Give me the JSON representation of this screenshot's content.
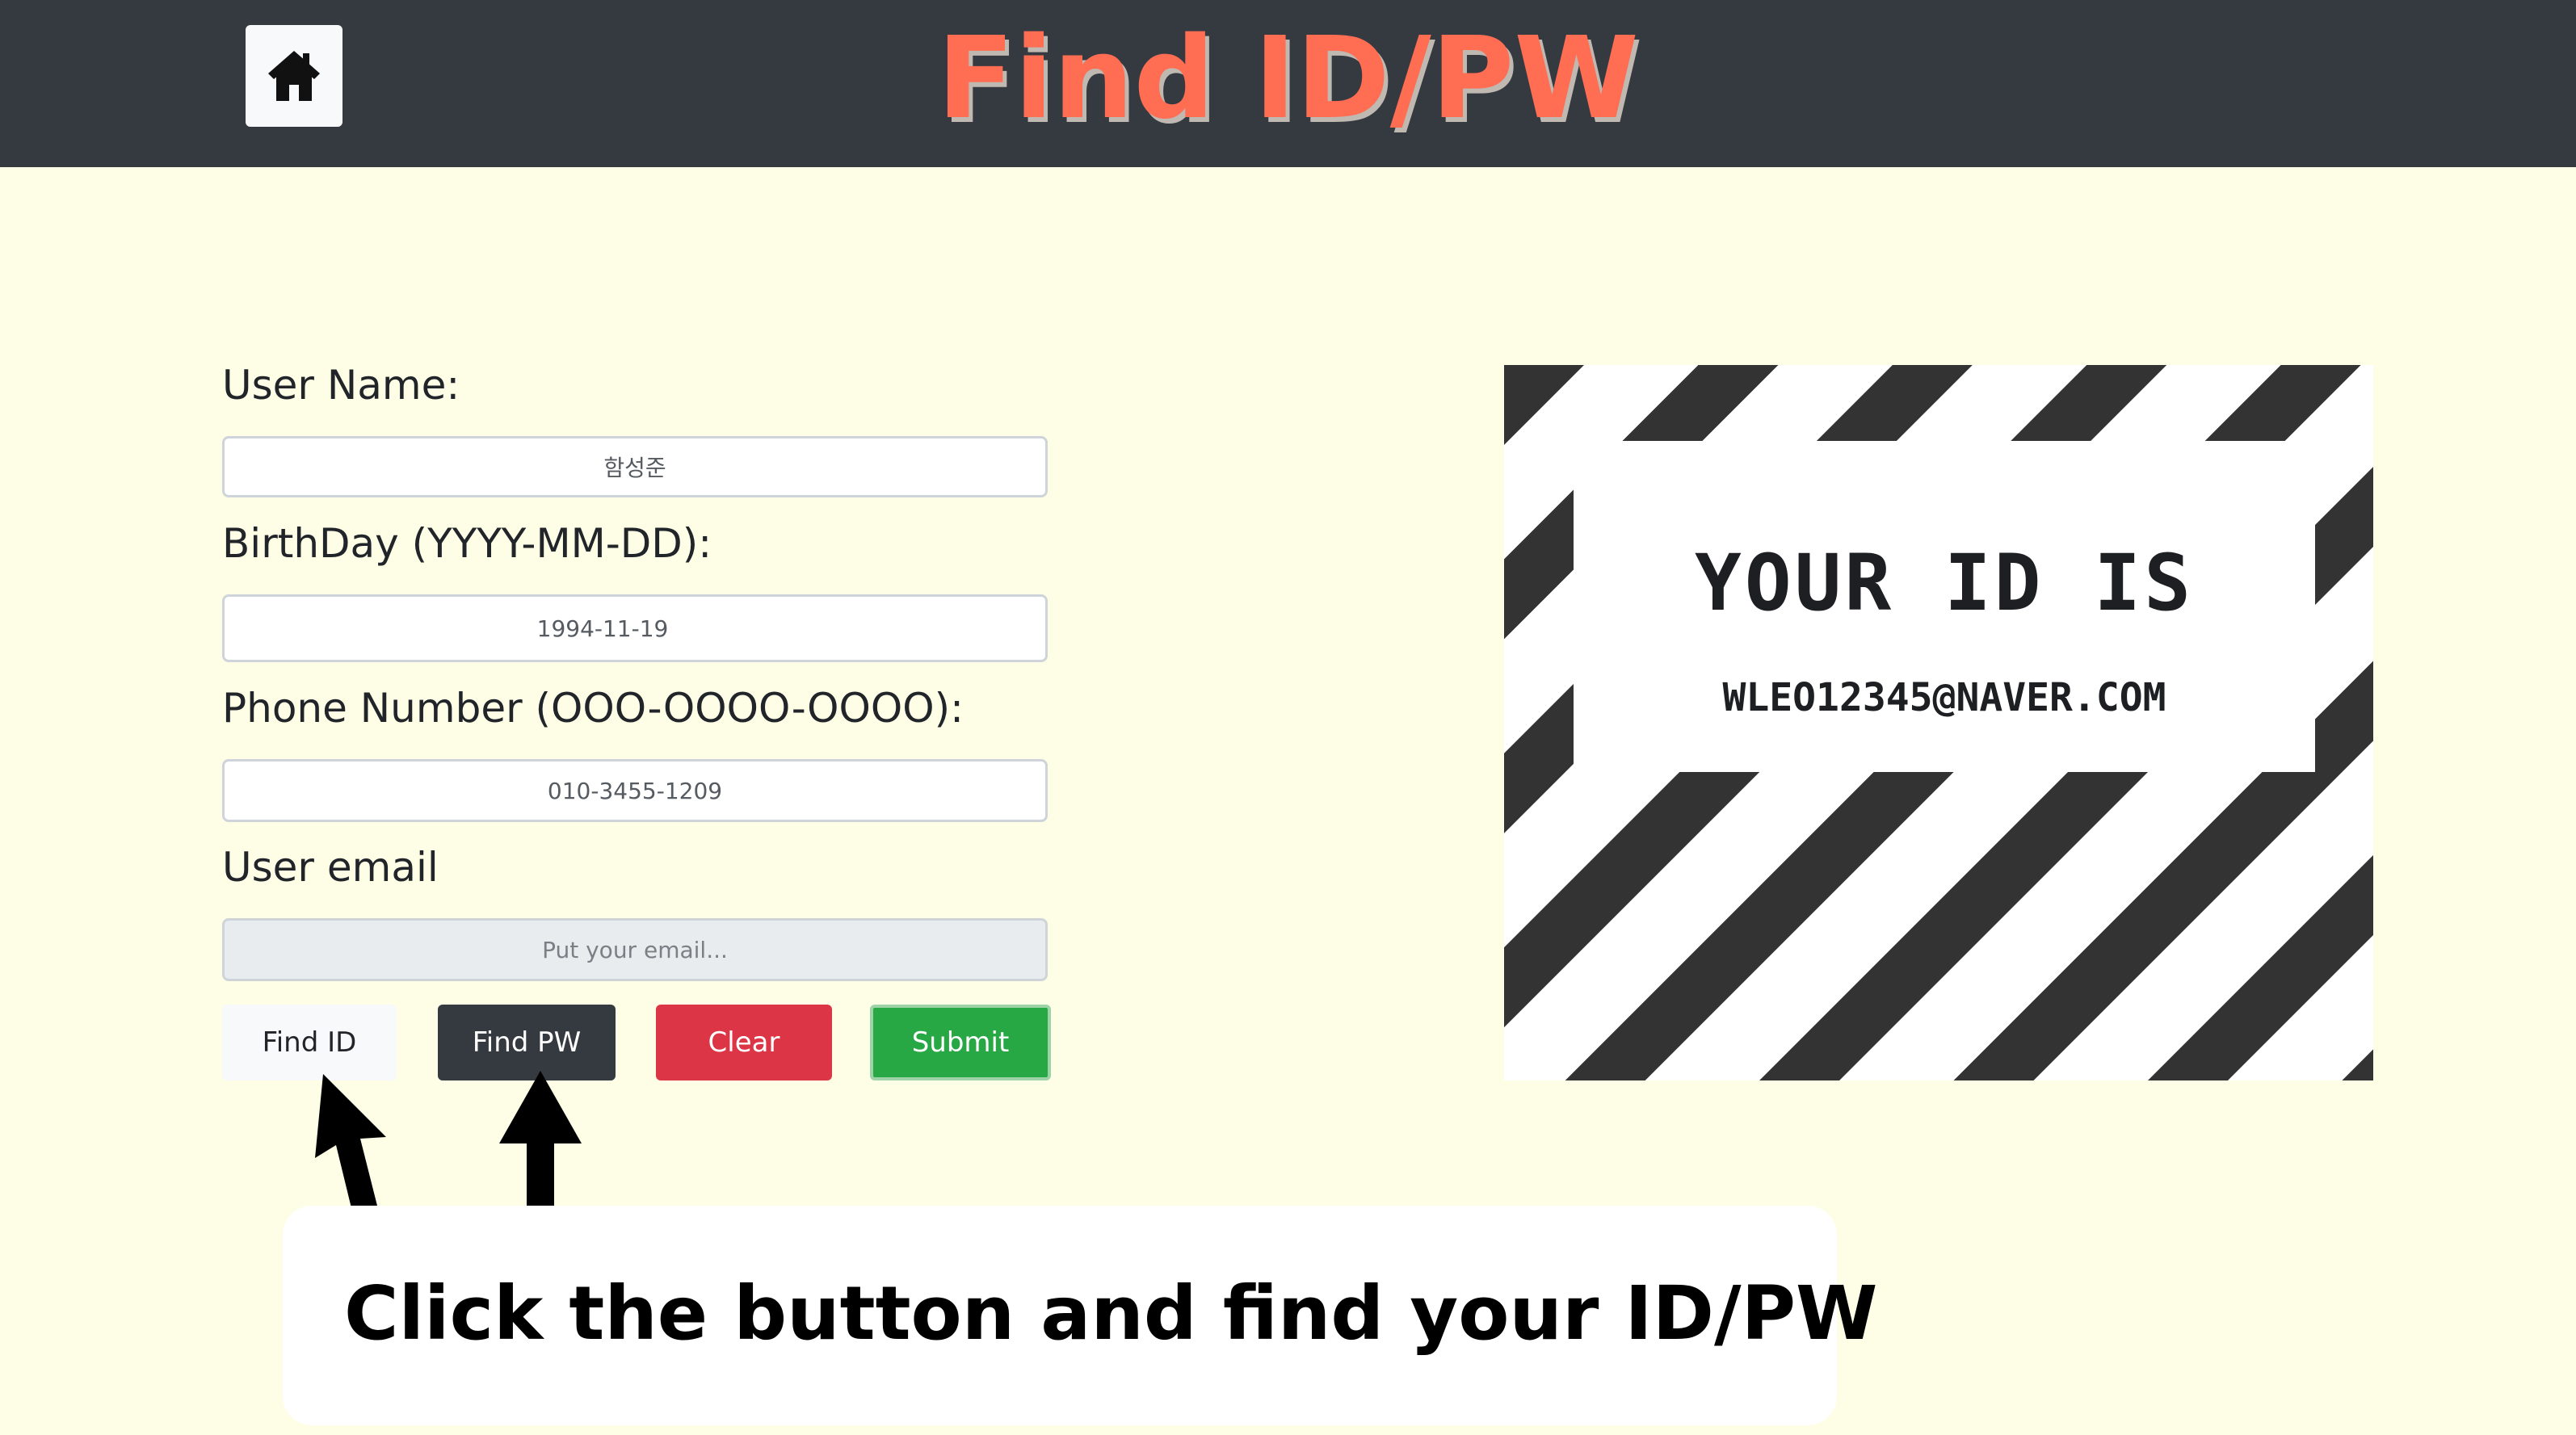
{
  "header": {
    "title": "Find ID/PW",
    "home_icon": "home-icon"
  },
  "form": {
    "fields": [
      {
        "label": "User Name:",
        "value": "함성준",
        "placeholder": ""
      },
      {
        "label": "BirthDay (YYYY-MM-DD):",
        "value": "1994-11-19",
        "placeholder": ""
      },
      {
        "label": "Phone Number (OOO-OOOO-OOOO):",
        "value": "010-3455-1209",
        "placeholder": ""
      },
      {
        "label": "User email",
        "value": "",
        "placeholder": "Put your email..."
      }
    ],
    "buttons": {
      "find_id": "Find ID",
      "find_pw": "Find PW",
      "clear": "Clear",
      "submit": "Submit"
    }
  },
  "result_card": {
    "title": "YOUR ID IS",
    "value": "WLEO12345@NAVER.COM"
  },
  "annotation": {
    "text": "Click the button and find your ID/PW"
  },
  "colors": {
    "header_bg": "#353a41",
    "page_bg": "#fefee6",
    "title": "#ff6d53",
    "find_pw_bg": "#343a40",
    "clear_bg": "#dc3545",
    "submit_bg": "#28a745"
  }
}
